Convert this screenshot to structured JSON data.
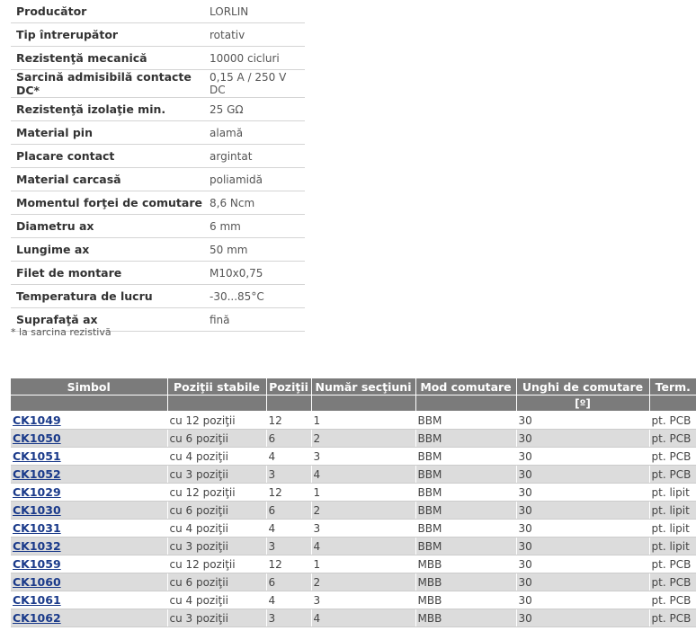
{
  "specs": [
    {
      "key": "Producător",
      "value": "LORLIN"
    },
    {
      "key": "Tip întrerupător",
      "value": "rotativ"
    },
    {
      "key": "Rezistenţă mecanică",
      "value": "10000 cicluri"
    },
    {
      "key": "Sarcină admisibilă contacte DC*",
      "value": "0,15 A / 250 V DC"
    },
    {
      "key": "Rezistenţă izolaţie min.",
      "value": "25 GΩ"
    },
    {
      "key": "Material pin",
      "value": "alamă"
    },
    {
      "key": "Placare contact",
      "value": "argintat"
    },
    {
      "key": "Material carcasă",
      "value": "poliamidă"
    },
    {
      "key": "Momentul forţei de comutare",
      "value": "8,6 Ncm"
    },
    {
      "key": "Diametru ax",
      "value": "6 mm"
    },
    {
      "key": "Lungime ax",
      "value": "50 mm"
    },
    {
      "key": "Filet de montare",
      "value": "M10x0,75"
    },
    {
      "key": "Temperatura de lucru",
      "value": "-30...85°C"
    },
    {
      "key": "Suprafaţă ax",
      "value": "fină"
    }
  ],
  "note": "* la sarcina rezistivă",
  "products": {
    "headers": [
      "Simbol",
      "Poziţii stabile",
      "Poziţii",
      "Număr secţiuni",
      "Mod comutare",
      "Unghi de comutare",
      "Term."
    ],
    "unit_header": "[º]",
    "rows": [
      [
        "CK1049",
        "cu 12 poziţii",
        "12",
        "1",
        "BBM",
        "30",
        "pt. PCB"
      ],
      [
        "CK1050",
        "cu 6 poziţii",
        "6",
        "2",
        "BBM",
        "30",
        "pt. PCB"
      ],
      [
        "CK1051",
        "cu 4 poziţii",
        "4",
        "3",
        "BBM",
        "30",
        "pt. PCB"
      ],
      [
        "CK1052",
        "cu 3 poziţii",
        "3",
        "4",
        "BBM",
        "30",
        "pt. PCB"
      ],
      [
        "CK1029",
        "cu 12 poziţii",
        "12",
        "1",
        "BBM",
        "30",
        "pt. lipit"
      ],
      [
        "CK1030",
        "cu 6 poziţii",
        "6",
        "2",
        "BBM",
        "30",
        "pt. lipit"
      ],
      [
        "CK1031",
        "cu 4 poziţii",
        "4",
        "3",
        "BBM",
        "30",
        "pt. lipit"
      ],
      [
        "CK1032",
        "cu 3 poziţii",
        "3",
        "4",
        "BBM",
        "30",
        "pt. lipit"
      ],
      [
        "CK1059",
        "cu 12 poziţii",
        "12",
        "1",
        "MBB",
        "30",
        "pt. PCB"
      ],
      [
        "CK1060",
        "cu 6 poziţii",
        "6",
        "2",
        "MBB",
        "30",
        "pt. PCB"
      ],
      [
        "CK1061",
        "cu 4 poziţii",
        "4",
        "3",
        "MBB",
        "30",
        "pt. PCB"
      ],
      [
        "CK1062",
        "cu 3 poziţii",
        "3",
        "4",
        "MBB",
        "30",
        "pt. PCB"
      ]
    ]
  }
}
